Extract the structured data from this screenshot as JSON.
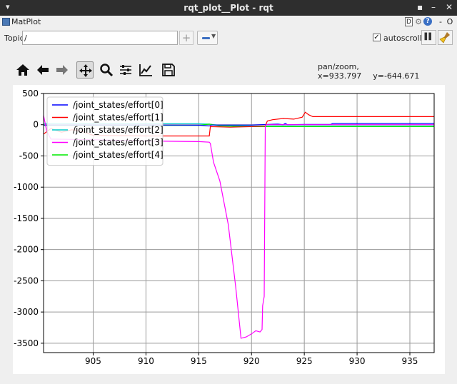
{
  "window": {
    "title": "rqt_plot__Plot - rqt",
    "menu_glyph": "▾",
    "pin_glyph": "▪",
    "minimize_glyph": "–",
    "close_glyph": "✕"
  },
  "dock": {
    "name": "MatPlot",
    "d_label": "D",
    "gear_glyph": "⚙",
    "help_label": "?",
    "min_label": "-",
    "close_label": "O"
  },
  "topic": {
    "label": "Topic",
    "value": "/",
    "add_glyph": "+",
    "autoscroll_checked": "✓",
    "autoscroll_label": "autoscroll",
    "pause_glyph": "▌▌"
  },
  "toolbar": {
    "items": [
      "home-icon",
      "back-icon",
      "forward-icon",
      "pan-icon",
      "zoom-icon",
      "subplots-icon",
      "axes-edit-icon",
      "save-icon"
    ],
    "active": "pan-icon"
  },
  "coordinates": {
    "mode_x": "pan/zoom, x=933.797",
    "y": "y=-644.671"
  },
  "chart_data": {
    "type": "line",
    "title": "",
    "xlabel": "",
    "ylabel": "",
    "xlim": [
      900.3,
      937.3
    ],
    "ylim": [
      -3650,
      500
    ],
    "xticks": [
      905,
      910,
      915,
      920,
      925,
      930,
      935
    ],
    "yticks": [
      500,
      0,
      -500,
      -1000,
      -1500,
      -2000,
      -2500,
      -3000,
      -3500
    ],
    "grid": true,
    "legend_position": "top-left",
    "series": [
      {
        "name": "/joint_states/effort[0]",
        "color": "#0000ff",
        "points": [
          [
            900.3,
            -5
          ],
          [
            905,
            -5
          ],
          [
            910,
            -5
          ],
          [
            915,
            -8
          ],
          [
            916,
            -20
          ],
          [
            916.2,
            -5
          ],
          [
            920,
            -5
          ],
          [
            921.5,
            5
          ],
          [
            922.5,
            10
          ],
          [
            923,
            0
          ],
          [
            923.2,
            20
          ],
          [
            923.4,
            0
          ],
          [
            925,
            5
          ],
          [
            927.5,
            5
          ],
          [
            927.7,
            20
          ],
          [
            937.3,
            20
          ]
        ]
      },
      {
        "name": "/joint_states/effort[1]",
        "color": "#ff0000",
        "points": [
          [
            900.3,
            -150
          ],
          [
            901,
            -60
          ],
          [
            902,
            -120
          ],
          [
            903,
            -80
          ],
          [
            904,
            -110
          ],
          [
            905,
            -170
          ],
          [
            910,
            -180
          ],
          [
            915,
            -180
          ],
          [
            916,
            -180
          ],
          [
            916.1,
            -30
          ],
          [
            918,
            -40
          ],
          [
            920,
            -30
          ],
          [
            921.3,
            -20
          ],
          [
            921.5,
            60
          ],
          [
            922,
            80
          ],
          [
            923,
            100
          ],
          [
            924,
            90
          ],
          [
            924.8,
            120
          ],
          [
            925.1,
            200
          ],
          [
            925.4,
            160
          ],
          [
            925.8,
            130
          ],
          [
            927,
            130
          ],
          [
            937.3,
            130
          ]
        ]
      },
      {
        "name": "/joint_states/effort[2]",
        "color": "#00cccc",
        "points": [
          [
            900.3,
            20
          ],
          [
            905,
            15
          ],
          [
            910,
            15
          ],
          [
            915,
            15
          ],
          [
            916,
            10
          ],
          [
            917,
            -10
          ],
          [
            920,
            -20
          ],
          [
            925,
            -20
          ],
          [
            930,
            -20
          ],
          [
            937.3,
            -20
          ]
        ]
      },
      {
        "name": "/joint_states/effort[3]",
        "color": "#ff00ff",
        "points": [
          [
            900.3,
            150
          ],
          [
            900.6,
            -100
          ],
          [
            901,
            -230
          ],
          [
            905,
            -240
          ],
          [
            910,
            -260
          ],
          [
            915,
            -270
          ],
          [
            916,
            -280
          ],
          [
            916.1,
            -300
          ],
          [
            916.4,
            -600
          ],
          [
            917,
            -900
          ],
          [
            917.8,
            -1600
          ],
          [
            918.5,
            -2600
          ],
          [
            919,
            -3420
          ],
          [
            919.5,
            -3400
          ],
          [
            920,
            -3350
          ],
          [
            920.4,
            -3300
          ],
          [
            920.8,
            -3320
          ],
          [
            921,
            -3280
          ],
          [
            921.05,
            -2900
          ],
          [
            921.2,
            -2750
          ],
          [
            921.3,
            -20
          ],
          [
            921.4,
            0
          ],
          [
            937.3,
            0
          ]
        ]
      },
      {
        "name": "/joint_states/effort[4]",
        "color": "#00ee00",
        "points": [
          [
            900.3,
            -10
          ],
          [
            905,
            -10
          ],
          [
            910,
            -10
          ],
          [
            915,
            -10
          ],
          [
            916,
            10
          ],
          [
            917,
            -20
          ],
          [
            920,
            -30
          ],
          [
            925,
            -30
          ],
          [
            930,
            -30
          ],
          [
            937.3,
            -30
          ]
        ]
      }
    ]
  }
}
